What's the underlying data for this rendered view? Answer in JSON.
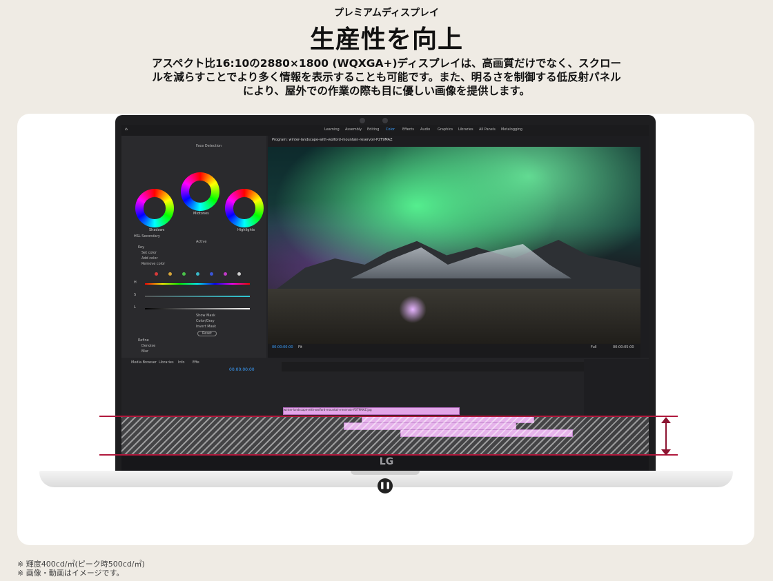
{
  "header": {
    "eyebrow": "プレミアムディスプレイ",
    "title": "生産性を向上",
    "description": "アスペクト比16:10の2880×1800 (WQXGA+)ディスプレイは、高画質だけでなく、スクロールを減らすことでより多く情報を表示することも可能です。また、明るさを制御する低反射パネルにより、屋外での作業の際も目に優しい画像を提供します。"
  },
  "laptop": {
    "brand": "LG",
    "video_control": {
      "icon": "pause-icon",
      "glyph": "❚❚"
    }
  },
  "editor": {
    "workspaces": [
      "Learning",
      "Assembly",
      "Editing",
      "Color",
      "Effects",
      "Audio",
      "Graphics",
      "Libraries",
      "All Panels",
      "Metalogging"
    ],
    "active_workspace": "Color",
    "left_panel": {
      "face_detection": "Face Detection",
      "wheels": [
        "Shadows",
        "Midtones",
        "Highlights"
      ],
      "hsl_secondary": "HSL Secondary",
      "active": "Active",
      "key": "Key",
      "set_color": "Set color",
      "add_color": "Add color",
      "remove_color": "Remove color",
      "show_mask": "Show Mask",
      "color_gray": "Color/Gray",
      "invert_mask": "Invert Mask",
      "reset": "Reset",
      "refine": "Refine",
      "denoise": "Denoise",
      "blur": "Blur",
      "h": "H",
      "s": "S",
      "l": "L"
    },
    "program": {
      "title": "Program: winter-landscape-with-wolford-mountain-reservoir-P2T9MAZ",
      "timecode_left": "00:00:00:00",
      "fit": "Fit",
      "full": "Full",
      "timecode_right": "00:00:05:00"
    },
    "bottom": {
      "tabs": [
        "Media Browser",
        "Libraries",
        "Info",
        "Effe"
      ],
      "sequence_time": "00:00:00:00",
      "clip_name": "winter-landscape-with-wolford-mountain-reservoir-P2T9MAZ.jpg"
    }
  },
  "notes": [
    "※ 輝度400cd/㎡(ピーク時500cd/㎡)",
    "※ 画像・動画はイメージです。"
  ],
  "colors": {
    "background": "#efebe4",
    "card": "#ffffff",
    "accent": "#a8173a",
    "clip": "#e2a6e8"
  }
}
